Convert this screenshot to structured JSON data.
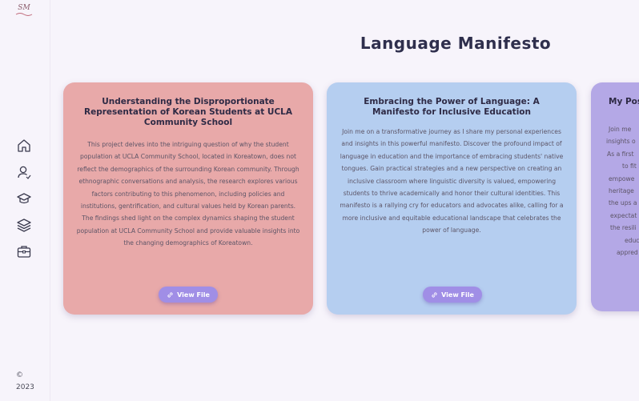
{
  "logo": {
    "text": "SM"
  },
  "sidebar": {
    "items": [
      {
        "icon": "home-icon"
      },
      {
        "icon": "user-icon"
      },
      {
        "icon": "graduation-cap-icon"
      },
      {
        "icon": "layers-icon"
      },
      {
        "icon": "briefcase-icon"
      }
    ],
    "footer": {
      "copyright": "©",
      "year": "2023"
    }
  },
  "page": {
    "title": "Language Manifesto"
  },
  "cards": [
    {
      "title": "Understanding the Disproportionate Representation of Korean Students at UCLA Community School",
      "body": "This project delves into the intriguing question of why the student population at UCLA Community School, located in Koreatown, does not reflect the demographics of the surrounding Korean community. Through ethnographic conversations and analysis, the research explores various factors contributing to this phenomenon, including policies and institutions, gentrification, and cultural values held by Korean parents. The findings shed light on the complex dynamics shaping the student population at UCLA Community School and provide valuable insights into the changing demographics of Koreatown.",
      "button": "View File",
      "color": "#e8a9a9"
    },
    {
      "title": "Embracing the Power of Language: A Manifesto for Inclusive Education",
      "body": "Join me on a transformative journey as I share my personal experiences and insights in this powerful manifesto. Discover the profound impact of language in education and the importance of embracing students' native tongues. Gain practical strategies and a new perspective on creating an inclusive classroom where linguistic diversity is valued, empowering students to thrive academically and honor their cultural identities. This manifesto is a rallying cry for educators and advocates alike, calling for a more inclusive and equitable educational landscape that celebrates the power of language.",
      "button": "View File",
      "color": "#b5cef0"
    },
    {
      "title": "My Pos",
      "fragments": [
        "Join me",
        "insights o",
        "As a first",
        "to fit i",
        "empowe",
        "heritage",
        "the ups a",
        "expectat",
        "the resili",
        "educ",
        "appred"
      ],
      "color": "#b4a8e6"
    }
  ],
  "colors": {
    "accent": "#a08ee6",
    "background": "#f7f4fb",
    "title": "#2f2f4d"
  }
}
